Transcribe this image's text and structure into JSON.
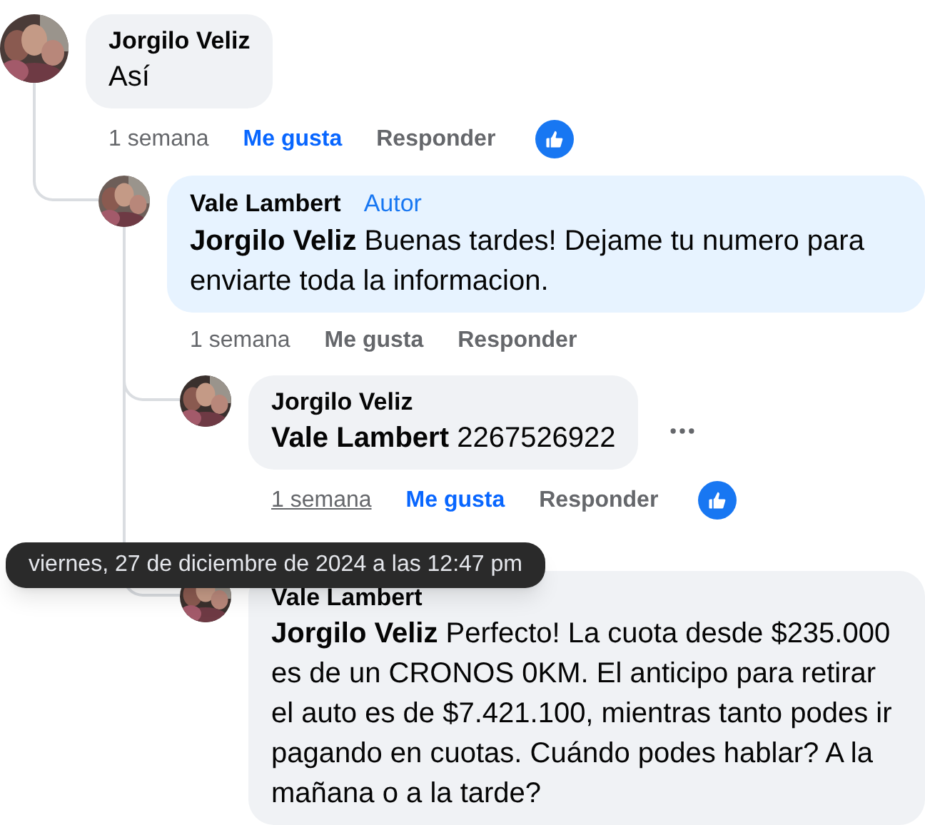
{
  "comments": [
    {
      "author": "Jorgilo Veliz",
      "text": "Así",
      "time": "1 semana",
      "time_hovered": false,
      "like": "Me gusta",
      "liked": true,
      "reply": "Responder",
      "reaction": true,
      "children": [
        {
          "author": "Vale Lambert",
          "badge": "Autor",
          "text": "**Jorgilo Veliz** Buenas tardes! Dejame tu numero para enviarte toda la informacion.",
          "time": "1 semana",
          "time_hovered": false,
          "like": "Me gusta",
          "liked": false,
          "reply": "Responder",
          "children": [
            {
              "author": "Jorgilo Veliz",
              "text": "**Vale Lambert** 2267526922",
              "time": "1 semana",
              "time_hovered": true,
              "like": "Me gusta",
              "liked": true,
              "reply": "Responder",
              "reaction": true,
              "menu": true
            },
            {
              "author": "Vale Lambert",
              "text": "**Jorgilo Veliz** Perfecto! La cuota desde $235.000 es de un CRONOS 0KM. El anticipo para retirar el auto es de $7.421.100, mientras tanto podes ir pagando en cuotas. Cuándo podes hablar? A la mañana o a la tarde?"
            }
          ]
        }
      ]
    }
  ],
  "tooltip": {
    "text": "viernes, 27 de diciembre de 2024 a las 12:47 pm"
  }
}
